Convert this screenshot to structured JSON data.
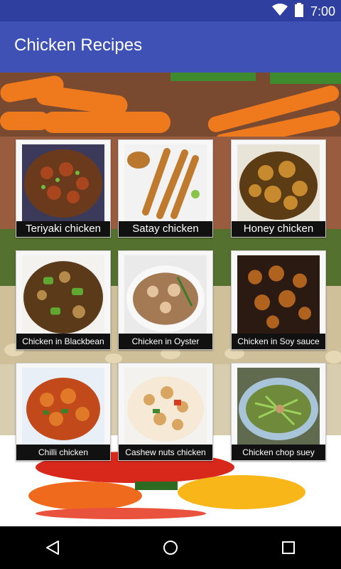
{
  "status_bar": {
    "time": "7:00",
    "icons": [
      "wifi-icon",
      "battery-icon"
    ]
  },
  "app_bar": {
    "title": "Chicken Recipes"
  },
  "recipes": [
    {
      "name": "Teriyaki chicken"
    },
    {
      "name": "Satay chicken"
    },
    {
      "name": "Honey chicken"
    },
    {
      "name": "Chicken in Blackbean"
    },
    {
      "name": "Chicken in Oyster"
    },
    {
      "name": "Chicken in Soy sauce"
    },
    {
      "name": "Chilli chicken"
    },
    {
      "name": "Cashew nuts chicken"
    },
    {
      "name": "Chicken chop suey"
    }
  ],
  "nav_bar": {
    "icons": [
      "back-icon",
      "home-icon",
      "recents-icon"
    ]
  },
  "colors": {
    "status_bar": "#2f3fa0",
    "app_bar": "#3f51b5",
    "label_bg": "#111111"
  }
}
